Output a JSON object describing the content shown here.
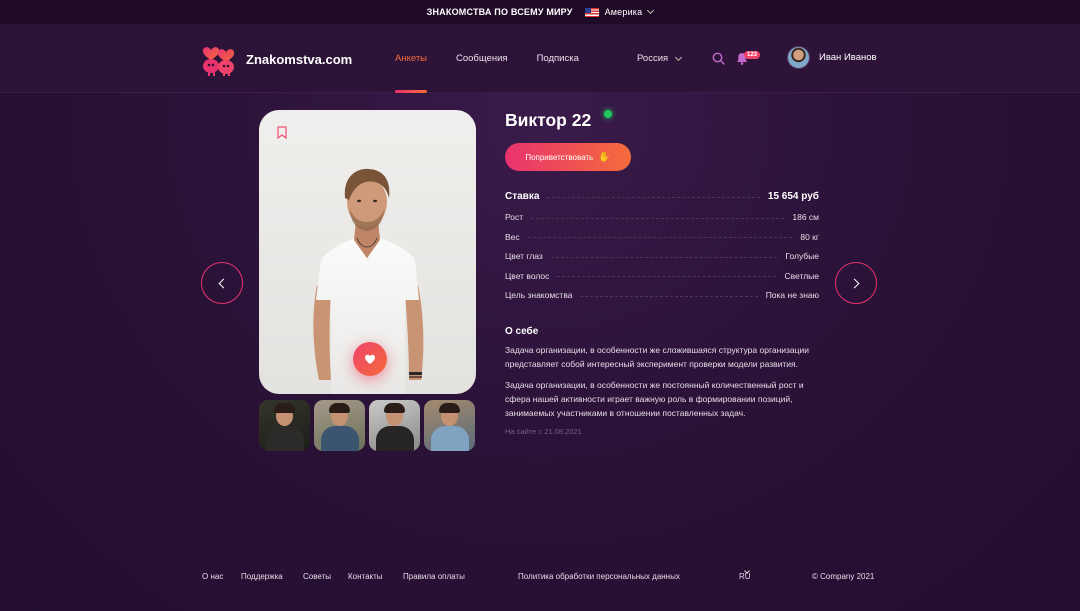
{
  "topbar": {
    "title": "ЗНАКОМСТВА ПО ВСЕМУ МИРУ",
    "region": "Америка",
    "flag_icon": "us-flag-icon"
  },
  "header": {
    "brand": "Znakomstva.com",
    "nav": [
      {
        "label": "Анкеты",
        "active": true
      },
      {
        "label": "Сообщения",
        "active": false
      },
      {
        "label": "Подписка",
        "active": false
      }
    ],
    "country": "Россия",
    "notifications_count": "123",
    "user_name": "Иван Иванов"
  },
  "profile": {
    "name": "Виктор 22",
    "online": true,
    "greet_label": "Поприветствовать",
    "rate": {
      "label": "Ставка",
      "value": "15 654 руб"
    },
    "attributes": [
      {
        "label": "Рост",
        "value": "186 см"
      },
      {
        "label": "Вес",
        "value": "80 кг"
      },
      {
        "label": "Цвет глаз",
        "value": "Голубые"
      },
      {
        "label": "Цвет волос",
        "value": "Светлые"
      },
      {
        "label": "Цель знакомства",
        "value": "Пока не знаю"
      }
    ],
    "about_heading": "О себе",
    "about_paragraphs": [
      "Задача организации, в особенности же сложившаяся структура организации представляет собой интересный эксперимент проверки модели развития.",
      "Задача организации, в особенности же постоянный количественный рост и сфера нашей активности играет важную роль в формировании позиций, занимаемых участниками в отношении поставленных задач."
    ],
    "since": "На сайте с 21.08.2021"
  },
  "footer": {
    "links": [
      "О нас",
      "Поддержка",
      "Советы",
      "Контакты",
      "Правила оплаты"
    ],
    "privacy": "Политика обработки персональных данных",
    "lang": "RU",
    "copyright": "© Company 2021"
  },
  "colors": {
    "accent_start": "#e8336e",
    "accent_end": "#f56b3b",
    "background": "#2b1238",
    "online": "#22c55e"
  }
}
